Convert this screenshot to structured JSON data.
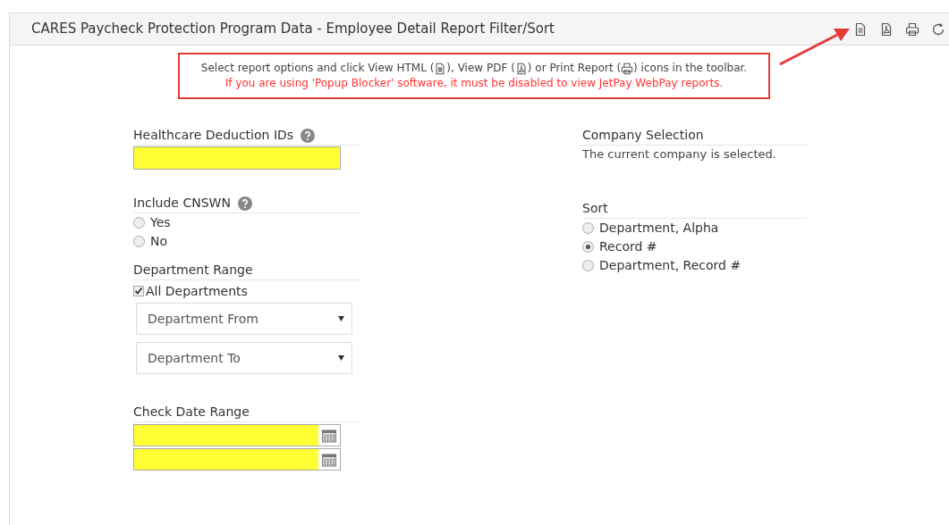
{
  "header": {
    "title": "CARES Paycheck Protection Program Data - Employee Detail Report Filter/Sort"
  },
  "notice": {
    "line_1_parts": [
      "Select report options and click View HTML (",
      "), View PDF (",
      ") or Print Report (",
      ") icons in the toolbar."
    ],
    "line_2": "If you are using 'Popup Blocker' software, it must be disabled to view JetPay WebPay reports."
  },
  "healthcare": {
    "label": "Healthcare Deduction IDs"
  },
  "include_cnswn": {
    "label": "Include CNSWN",
    "options": [
      {
        "label": "Yes",
        "selected": false
      },
      {
        "label": "No",
        "selected": false
      }
    ]
  },
  "department_range": {
    "label": "Department Range",
    "all": {
      "label": "All Departments",
      "checked": true
    },
    "selects": [
      {
        "placeholder": "Department From"
      },
      {
        "placeholder": "Department To"
      }
    ]
  },
  "check_date_range": {
    "label": "Check Date Range",
    "fields": [
      {
        "kind": "date"
      },
      {
        "kind": "date"
      }
    ]
  },
  "company_selection": {
    "label": "Company Selection",
    "text": "The current company is selected."
  },
  "sort": {
    "label": "Sort",
    "options": [
      {
        "label": "Department, Alpha",
        "selected": false
      },
      {
        "label": "Record #",
        "selected": true
      },
      {
        "label": "Department, Record #",
        "selected": false
      }
    ]
  }
}
